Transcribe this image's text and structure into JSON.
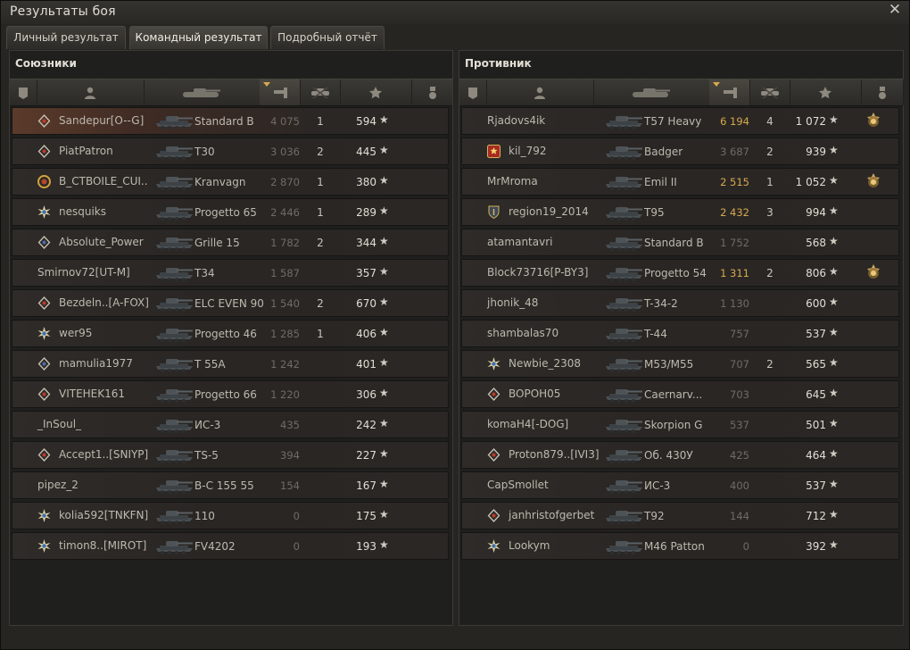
{
  "window": {
    "title": "Результаты боя",
    "close_icon": "close-icon"
  },
  "tabs": [
    {
      "label": "Личный результат",
      "active": false
    },
    {
      "label": "Командный результат",
      "active": true
    },
    {
      "label": "Подробный отчёт",
      "active": false
    }
  ],
  "columns": [
    "platoon-icon",
    "player-icon",
    "tank-icon",
    "damage-icon",
    "frags-icon",
    "experience-star-icon",
    "medal-icon"
  ],
  "sorted_column": "damage-icon",
  "teams": [
    {
      "title": "Союзники",
      "rows": [
        {
          "player": "Sandepur[O--G]",
          "badge": "diamond",
          "tank": "Standard B",
          "damage": "4 075",
          "frags": "1",
          "xp": "594",
          "highlight": true
        },
        {
          "player": "PiatPatron",
          "badge": "diamond",
          "tank": "T30",
          "damage": "3 036",
          "frags": "2",
          "xp": "445"
        },
        {
          "player": "B_CTBOILE_CUI..",
          "badge": "gold-ring",
          "tank": "Kranvagn",
          "damage": "2 870",
          "frags": "1",
          "xp": "380"
        },
        {
          "player": "nesquiks",
          "badge": "star-burst",
          "tank": "Progetto 65",
          "damage": "2 446",
          "frags": "1",
          "xp": "289"
        },
        {
          "player": "Absolute_Power",
          "badge": "diamond-blue",
          "tank": "Grille 15",
          "damage": "1 782",
          "frags": "2",
          "xp": "344"
        },
        {
          "player": "Smirnov72[UT-M]",
          "badge": "",
          "tank": "T34",
          "damage": "1 587",
          "frags": "",
          "xp": "357"
        },
        {
          "player": "Bezdeln..[A-FOX]",
          "badge": "diamond",
          "tank": "ELC EVEN 90",
          "damage": "1 540",
          "frags": "2",
          "xp": "670"
        },
        {
          "player": "wer95",
          "badge": "star-burst",
          "tank": "Progetto 46",
          "damage": "1 285",
          "frags": "1",
          "xp": "406"
        },
        {
          "player": "mamulia1977",
          "badge": "diamond-blue",
          "tank": "T 55A",
          "damage": "1 242",
          "frags": "",
          "xp": "401"
        },
        {
          "player": "VITEHEK161",
          "badge": "diamond",
          "tank": "Progetto 66",
          "damage": "1 220",
          "frags": "",
          "xp": "306"
        },
        {
          "player": "_InSoul_",
          "badge": "",
          "tank": "ИС-3",
          "damage": "435",
          "frags": "",
          "xp": "242"
        },
        {
          "player": "Accept1..[SNIYP]",
          "badge": "diamond",
          "tank": "TS-5",
          "damage": "394",
          "frags": "",
          "xp": "227"
        },
        {
          "player": "pipez_2",
          "badge": "",
          "tank": "B-C 155 55",
          "damage": "154",
          "frags": "",
          "xp": "167"
        },
        {
          "player": "kolia592[TNKFN]",
          "badge": "star-burst",
          "tank": "110",
          "damage": "0",
          "frags": "",
          "xp": "175"
        },
        {
          "player": "timon8..[MIROT]",
          "badge": "star-burst",
          "tank": "FV4202",
          "damage": "0",
          "frags": "",
          "xp": "193"
        }
      ]
    },
    {
      "title": "Противник",
      "rows": [
        {
          "player": "Rjadovs4ik",
          "badge": "",
          "tank": "T57 Heavy",
          "damage": "6 194",
          "frags": "4",
          "xp": "1 072",
          "medal": true,
          "dmg_hi": true
        },
        {
          "player": "kil_792",
          "badge": "red-star",
          "tank": "Badger",
          "damage": "3 687",
          "frags": "2",
          "xp": "939"
        },
        {
          "player": "MrMroma",
          "badge": "",
          "tank": "Emil II",
          "damage": "2 515",
          "frags": "1",
          "xp": "1 052",
          "medal": true,
          "dmg_hi": true
        },
        {
          "player": "region19_2014",
          "badge": "shield",
          "tank": "T95",
          "damage": "2 432",
          "frags": "3",
          "xp": "994",
          "dmg_hi": true
        },
        {
          "player": "atamantavri",
          "badge": "",
          "tank": "Standard B",
          "damage": "1 752",
          "frags": "",
          "xp": "568"
        },
        {
          "player": "Block73716[P-BY3]",
          "badge": "",
          "tank": "Progetto 54",
          "damage": "1 311",
          "frags": "2",
          "xp": "806",
          "medal": true,
          "dmg_hi": true
        },
        {
          "player": "jhonik_48",
          "badge": "",
          "tank": "T-34-2",
          "damage": "1 130",
          "frags": "",
          "xp": "600"
        },
        {
          "player": "shambalas70",
          "badge": "",
          "tank": "T-44",
          "damage": "757",
          "frags": "",
          "xp": "537"
        },
        {
          "player": "Newbie_2308",
          "badge": "star-burst",
          "tank": "M53/M55",
          "damage": "707",
          "frags": "2",
          "xp": "565"
        },
        {
          "player": "BOPOH05",
          "badge": "diamond",
          "tank": "Caernarv...",
          "damage": "703",
          "frags": "",
          "xp": "645"
        },
        {
          "player": "komaH4[-DOG]",
          "badge": "",
          "tank": "Skorpion G",
          "damage": "537",
          "frags": "",
          "xp": "501"
        },
        {
          "player": "Proton879..[IVI3]",
          "badge": "diamond",
          "tank": "Об. 430У",
          "damage": "425",
          "frags": "",
          "xp": "464"
        },
        {
          "player": "CapSmollet",
          "badge": "",
          "tank": "ИС-3",
          "damage": "400",
          "frags": "",
          "xp": "537"
        },
        {
          "player": "janhristofgerbet",
          "badge": "diamond",
          "tank": "T92",
          "damage": "144",
          "frags": "",
          "xp": "712"
        },
        {
          "player": "Lookym",
          "badge": "star-burst",
          "tank": "M46 Patton",
          "damage": "0",
          "frags": "",
          "xp": "392"
        }
      ]
    }
  ],
  "star_glyph": "★"
}
